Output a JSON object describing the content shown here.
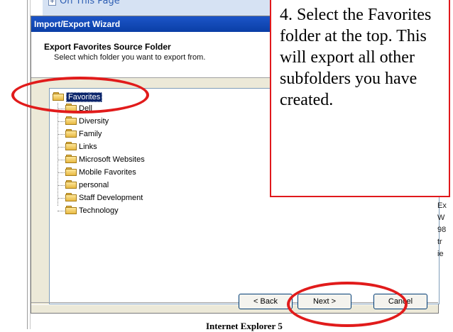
{
  "background_doc": {
    "on_this_page": "On This Page",
    "footer": "Internet Explorer 5",
    "side_fragments": [
      "Ex",
      "W",
      "98",
      "tr",
      "ie"
    ]
  },
  "wizard": {
    "title": "Import/Export Wizard",
    "heading": "Export Favorites Source Folder",
    "subheading": "Select which folder you want to export from.",
    "tree": {
      "root": "Favorites",
      "children": [
        "Dell",
        "Diversity",
        "Family",
        "Links",
        "Microsoft Websites",
        "Mobile Favorites",
        "personal",
        "Staff Development",
        "Technology"
      ]
    },
    "buttons": {
      "back": "< Back",
      "next": "Next >",
      "cancel": "Cancel"
    }
  },
  "callout": {
    "text": "4.  Select the Favorites folder at the top.  This will export all other subfolders you have created."
  },
  "colors": {
    "annotation_red": "#e11b1b",
    "title_blue": "#0a3ea6",
    "selection": "#0a246a"
  }
}
